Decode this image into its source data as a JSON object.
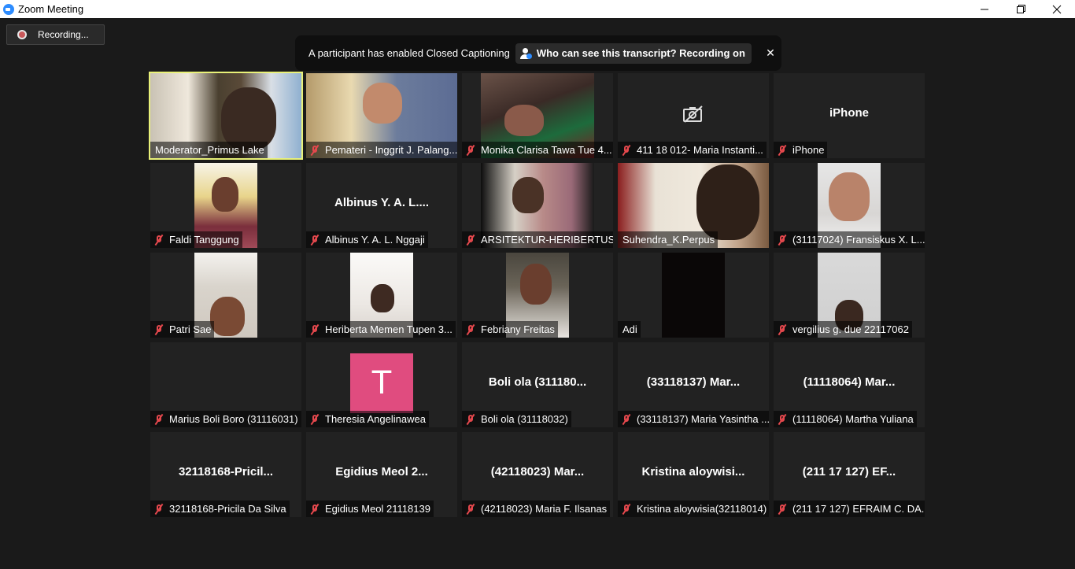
{
  "window": {
    "title": "Zoom Meeting"
  },
  "recording": {
    "label": "Recording..."
  },
  "captions_banner": {
    "message": "A participant has enabled Closed Captioning",
    "link_label": "Who can see this transcript? Recording on",
    "close_glyph": "✕"
  },
  "participants": [
    {
      "caption": "Moderator_Primus Lake",
      "muted": false,
      "active_speaker": true,
      "video": true
    },
    {
      "caption": "Pemateri - Inggrit J. Palang...",
      "muted": true,
      "video": true
    },
    {
      "caption": "Monika Clarisa Tawa Tue 4...",
      "muted": true,
      "video": true
    },
    {
      "caption": "411 18 012- Maria Instanti...",
      "muted": true,
      "video": false,
      "camera_off_icon": true
    },
    {
      "caption": "iPhone",
      "muted": true,
      "video": false,
      "big_name": "iPhone"
    },
    {
      "caption": "Faldi Tanggung",
      "muted": true,
      "video": true
    },
    {
      "caption": "Albinus Y. A. L. Nggaji",
      "muted": true,
      "video": false,
      "big_name": "Albinus Y. A. L...."
    },
    {
      "caption": "ARSITEKTUR-HERIBERTUS ...",
      "muted": true,
      "video": true
    },
    {
      "caption": "Suhendra_K.Perpus",
      "muted": false,
      "video": true
    },
    {
      "caption": "(31117024) Fransiskus X. L...",
      "muted": true,
      "video": true
    },
    {
      "caption": "Patri Sae",
      "muted": true,
      "video": true
    },
    {
      "caption": "Heriberta Memen Tupen 3...",
      "muted": true,
      "video": true
    },
    {
      "caption": "Febriany Freitas",
      "muted": true,
      "video": true
    },
    {
      "caption": "Adi",
      "muted": false,
      "video": true
    },
    {
      "caption": "vergilius g. due 22117062",
      "muted": true,
      "video": true
    },
    {
      "caption": "Marius Boli Boro (31116031)",
      "muted": true,
      "video": false
    },
    {
      "caption": "Theresia Angelinawea",
      "muted": true,
      "video": false,
      "avatar_letter": "T"
    },
    {
      "caption": "Boli ola (31118032)",
      "muted": true,
      "video": false,
      "big_name": "Boli ola (311180..."
    },
    {
      "caption": "(33118137) Maria Yasintha ...",
      "muted": true,
      "video": false,
      "big_name": "(33118137) Mar..."
    },
    {
      "caption": "(11118064) Martha Yuliana",
      "muted": true,
      "video": false,
      "big_name": "(11118064) Mar..."
    },
    {
      "caption": "32118168-Pricila Da Silva",
      "muted": true,
      "video": false,
      "big_name": "32118168-Pricil..."
    },
    {
      "caption": "Egidius Meol  21118139",
      "muted": true,
      "video": false,
      "big_name": "Egidius Meol  2..."
    },
    {
      "caption": "(42118023) Maria F. Ilsanas",
      "muted": true,
      "video": false,
      "big_name": "(42118023) Mar..."
    },
    {
      "caption": "Kristina aloywisia(32118014)",
      "muted": true,
      "video": false,
      "big_name": "Kristina  aloywisi..."
    },
    {
      "caption": "(211 17 127) EFRAIM C. DA...",
      "muted": true,
      "video": false,
      "big_name": "(211 17 127) EF..."
    }
  ],
  "colors": {
    "background": "#1a1a1a",
    "tile": "#222222",
    "active_speaker_border": "#e9f178",
    "muted_icon": "#e5484d",
    "avatar": "#e04c7f"
  }
}
